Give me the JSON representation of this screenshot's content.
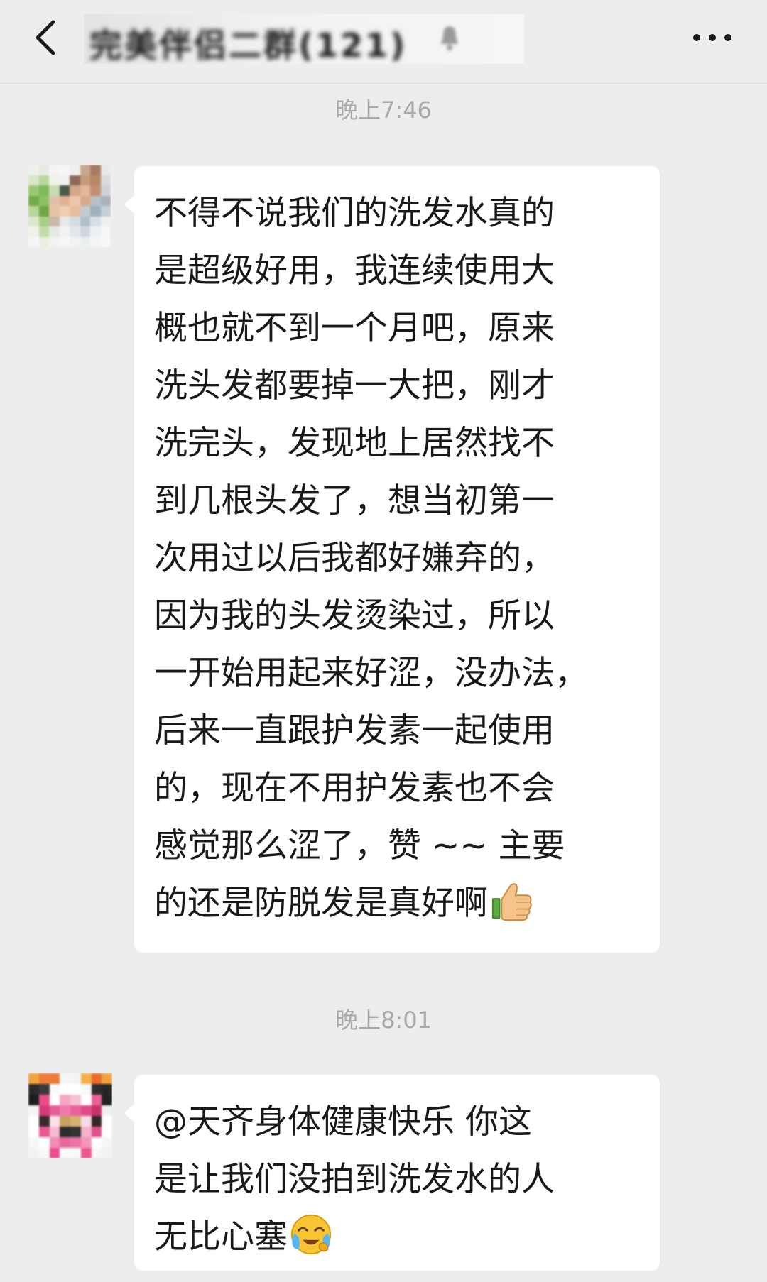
{
  "header": {
    "group_name_obscured": "完美伴侣二群(121)",
    "back_icon": "chevron-left-icon",
    "more_icon": "more-dots-icon",
    "muted_icon": "muted-icon"
  },
  "messages": [
    {
      "timestamp": "晚上7:46",
      "sender": "member-1",
      "lines": [
        "不得不说我们的洗发水真的",
        "是超级好用，我连续使用大",
        "概也就不到一个月吧，原来",
        "洗头发都要掉一大把，刚才",
        "洗完头，发现地上居然找不",
        "到几根头发了，想当初第一",
        "次用过以后我都好嫌弃的，",
        "因为我的头发烫染过，所以",
        "一开始用起来好涩，没办法，",
        "后来一直跟护发素一起使用",
        "的，现在不用护发素也不会",
        "感觉那么涩了，赞 ~~ 主要",
        "的还是防脱发是真好啊"
      ],
      "trailing_emoji": "thumbs-up-icon"
    },
    {
      "timestamp": "晚上8:01",
      "sender": "member-2",
      "lines": [
        "@天齐身体健康快乐 你这",
        "是让我们没拍到洗发水的人",
        "无比心塞"
      ],
      "trailing_emoji": "crying-face-icon"
    }
  ],
  "colors": {
    "background": "#ededed",
    "bubble": "#ffffff",
    "timestamp_text": "#a9a9a9",
    "message_text": "#191919"
  }
}
